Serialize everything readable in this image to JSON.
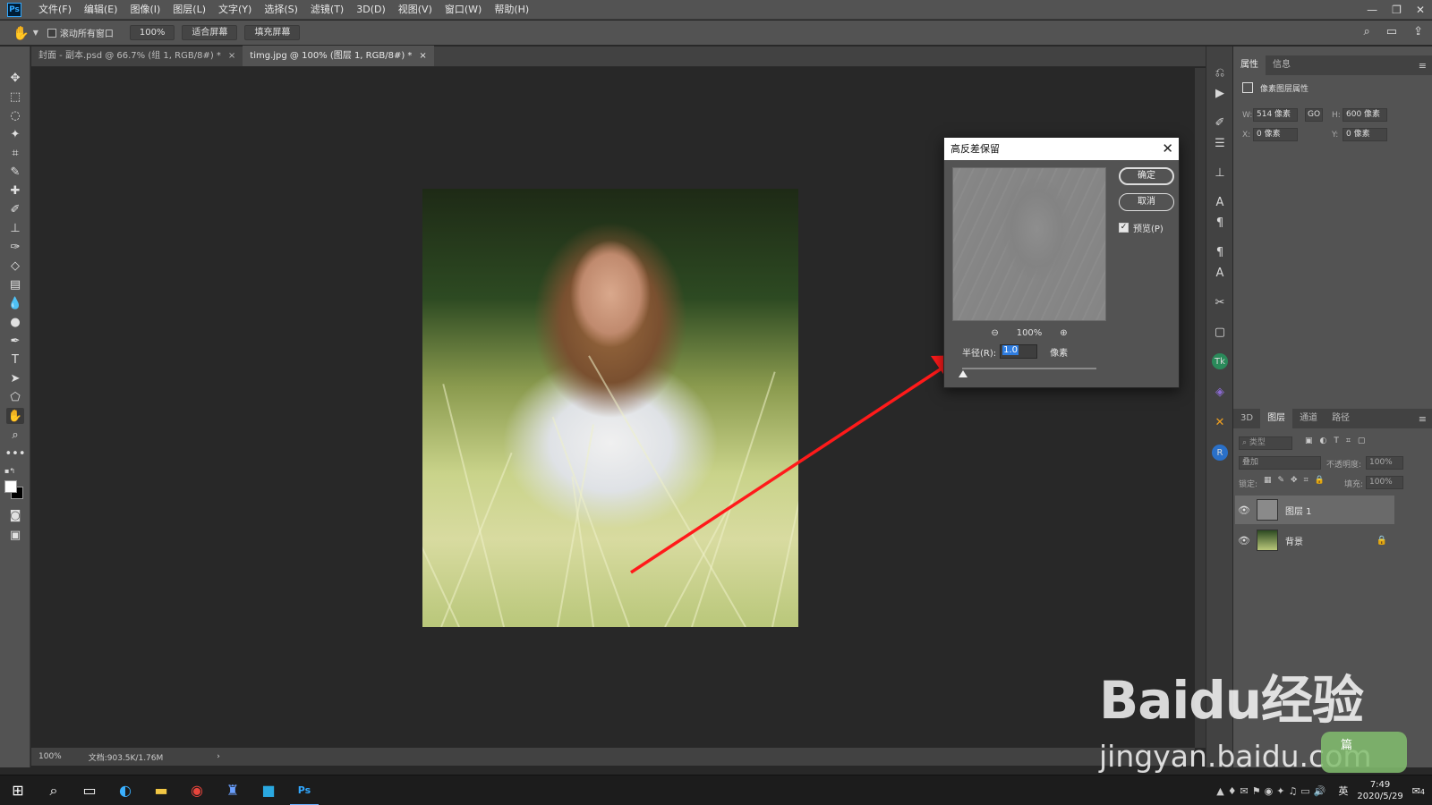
{
  "menubar": {
    "logo": "Ps",
    "items": [
      "文件(F)",
      "编辑(E)",
      "图像(I)",
      "图层(L)",
      "文字(Y)",
      "选择(S)",
      "滤镜(T)",
      "3D(D)",
      "视图(V)",
      "窗口(W)",
      "帮助(H)"
    ]
  },
  "options": {
    "scroll_all": "滚动所有窗口",
    "zoom": "100%",
    "fit_screen": "适合屏幕",
    "fill_screen": "填充屏幕"
  },
  "tabs": [
    {
      "label": "封面 - 副本.psd @ 66.7% (组 1, RGB/8#) *"
    },
    {
      "label": "timg.jpg @ 100% (图层 1, RGB/8#) *"
    }
  ],
  "status": {
    "zoom": "100%",
    "doc": "文档:903.5K/1.76M"
  },
  "properties": {
    "tabs": [
      "属性",
      "信息"
    ],
    "title": "像素图层属性",
    "w_label": "W:",
    "w_value": "514 像素",
    "h_label": "H:",
    "h_value": "600 像素",
    "link": "GO",
    "x_label": "X:",
    "x_value": "0 像素",
    "y_label": "Y:",
    "y_value": "0 像素"
  },
  "layers": {
    "tabs": [
      "3D",
      "图层",
      "通道",
      "路径"
    ],
    "filter_placeholder": "类型",
    "blend_mode": "叠加",
    "opacity_label": "不透明度:",
    "opacity_value": "100%",
    "lock_label": "锁定:",
    "fill_label": "填充:",
    "fill_value": "100%",
    "items": [
      {
        "name": "图层 1"
      },
      {
        "name": "背景"
      }
    ]
  },
  "dialog": {
    "title": "高反差保留",
    "ok": "确定",
    "cancel": "取消",
    "preview": "预览(P)",
    "zoom": "100%",
    "radius_label": "半径(R):",
    "radius_value": "1.0",
    "unit": "像素"
  },
  "taskbar": {
    "time": "7:49",
    "date": "2020/5/29",
    "ime": "英",
    "notifications": "4"
  },
  "watermark": {
    "logo": "Baidu经验",
    "url": "jingyan.baidu.com",
    "badge": "篇"
  }
}
